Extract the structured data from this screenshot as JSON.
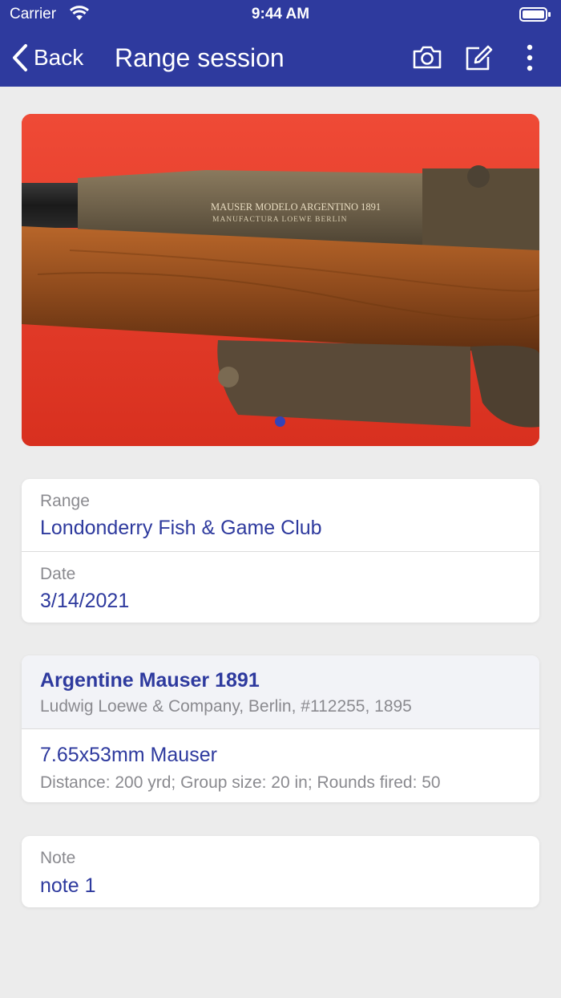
{
  "status_bar": {
    "carrier": "Carrier",
    "time": "9:44 AM"
  },
  "nav": {
    "back_label": "Back",
    "title": "Range session"
  },
  "photo": {
    "engraving_line1": "MAUSER MODELO ARGENTINO 1891",
    "engraving_line2": "MANUFACTURA LOEWE BERLIN"
  },
  "session": {
    "range_label": "Range",
    "range_value": "Londonderry Fish & Game Club",
    "date_label": "Date",
    "date_value": "3/14/2021"
  },
  "firearm": {
    "name": "Argentine Mauser 1891",
    "details": "Ludwig Loewe & Company, Berlin, #112255, 1895",
    "ammo": "7.65x53mm Mauser",
    "stats": "Distance: 200 yrd; Group size: 20 in; Rounds fired: 50"
  },
  "note": {
    "label": "Note",
    "value": "note 1"
  },
  "colors": {
    "nav_bg": "#2e3a9e",
    "accent": "#2e3a9e",
    "photo_bg": "#e63a2a"
  }
}
